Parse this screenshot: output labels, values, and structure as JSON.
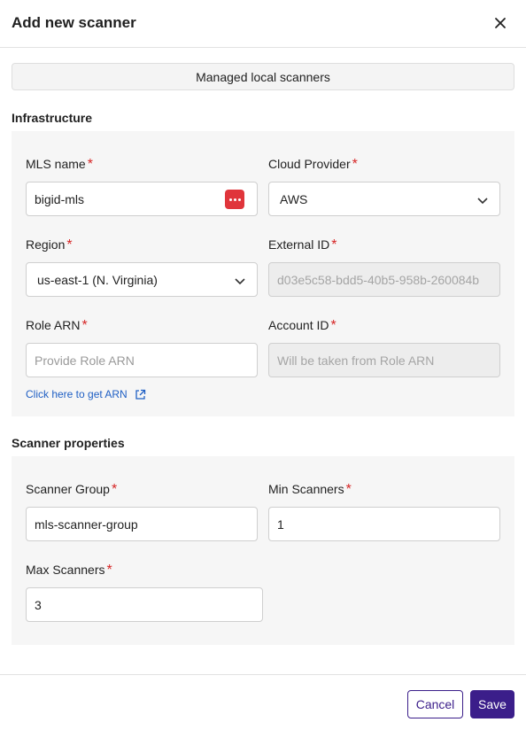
{
  "dialog": {
    "title": "Add new scanner"
  },
  "tab": {
    "label": "Managed local scanners"
  },
  "infrastructure": {
    "title": "Infrastructure",
    "mls_name": {
      "label": "MLS name",
      "value": "bigid-mls"
    },
    "cloud_provider": {
      "label": "Cloud Provider",
      "value": "AWS"
    },
    "region": {
      "label": "Region",
      "value": "us-east-1 (N. Virginia)"
    },
    "external_id": {
      "label": "External ID",
      "value": "d03e5c58-bdd5-40b5-958b-260084b"
    },
    "role_arn": {
      "label": "Role ARN",
      "placeholder": "Provide Role ARN"
    },
    "account_id": {
      "label": "Account ID",
      "placeholder": "Will be taken from Role ARN"
    },
    "link": "Click here to get ARN"
  },
  "scanner_properties": {
    "title": "Scanner properties",
    "scanner_group": {
      "label": "Scanner Group",
      "value": "mls-scanner-group"
    },
    "min_scanners": {
      "label": "Min Scanners",
      "value": "1"
    },
    "max_scanners": {
      "label": "Max Scanners",
      "value": "3"
    }
  },
  "required_marker": "*",
  "footer": {
    "cancel": "Cancel",
    "save": "Save"
  },
  "colors": {
    "primary": "#3b1e8a",
    "required": "#d62525",
    "link": "#1f5fc4",
    "password_icon": "#e0353b"
  }
}
